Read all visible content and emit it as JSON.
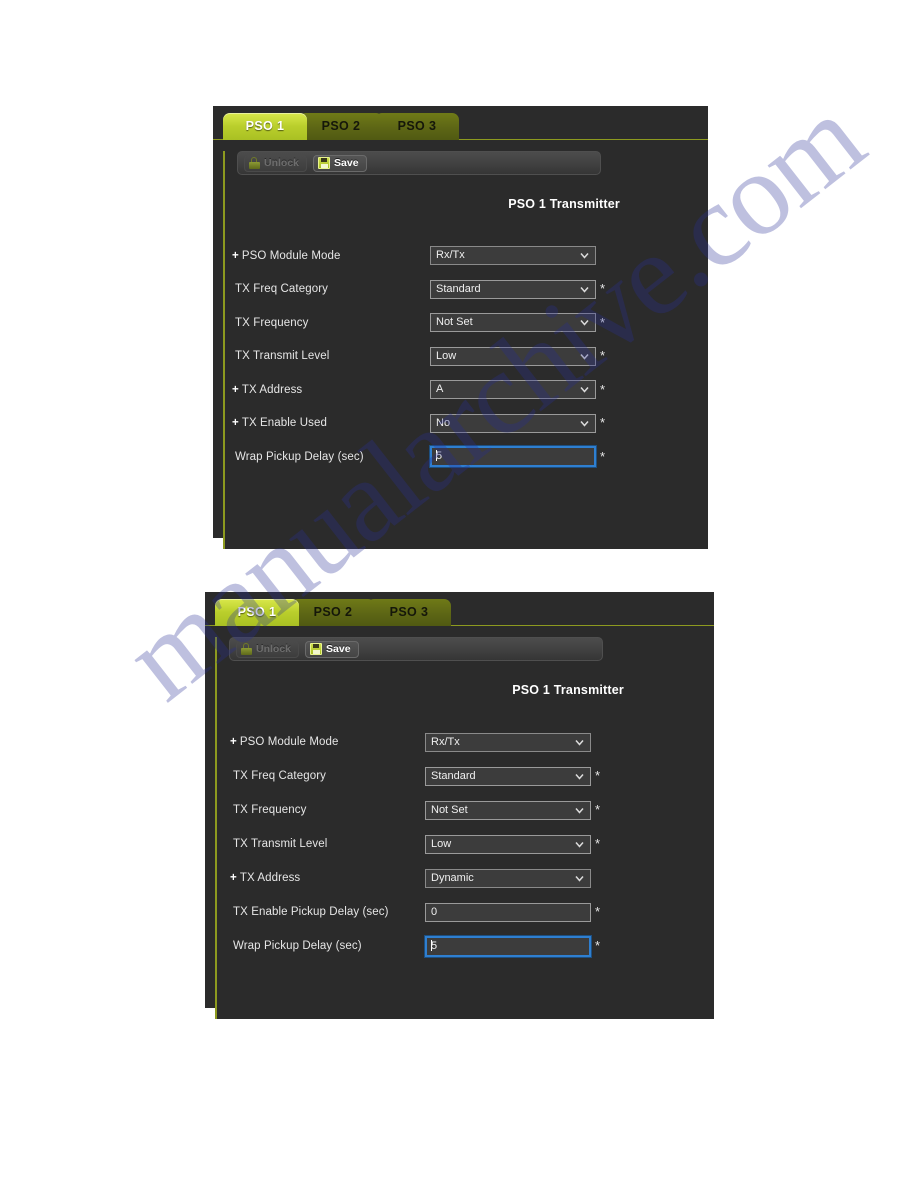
{
  "watermark": {
    "text": "manualarchive.com"
  },
  "panels": [
    {
      "id": "panel-1",
      "tabs": [
        {
          "label": "PSO 1",
          "active": true
        },
        {
          "label": "PSO 2",
          "active": false
        },
        {
          "label": "PSO 3",
          "active": false
        }
      ],
      "toolbar": {
        "unlock_label": "Unlock",
        "save_label": "Save"
      },
      "title": "PSO 1 Transmitter",
      "rows": [
        {
          "plus": "+",
          "label": "PSO Module Mode",
          "type": "select",
          "value": "Rx/Tx",
          "required": false
        },
        {
          "plus": "",
          "label": "TX Freq Category",
          "type": "select",
          "value": "Standard",
          "required": true
        },
        {
          "plus": "",
          "label": "TX Frequency",
          "type": "select",
          "value": "Not Set",
          "required": true
        },
        {
          "plus": "",
          "label": "TX Transmit Level",
          "type": "select",
          "value": "Low",
          "required": true
        },
        {
          "plus": "+",
          "label": "TX Address",
          "type": "select",
          "value": "A",
          "required": true
        },
        {
          "plus": "+",
          "label": "TX Enable Used",
          "type": "select",
          "value": "No",
          "required": true
        },
        {
          "plus": "",
          "label": "Wrap Pickup Delay (sec)",
          "type": "text",
          "value": "5",
          "required": true,
          "focused": true
        }
      ]
    },
    {
      "id": "panel-2",
      "tabs": [
        {
          "label": "PSO 1",
          "active": true
        },
        {
          "label": "PSO 2",
          "active": false
        },
        {
          "label": "PSO 3",
          "active": false
        }
      ],
      "toolbar": {
        "unlock_label": "Unlock",
        "save_label": "Save"
      },
      "title": "PSO 1 Transmitter",
      "rows": [
        {
          "plus": "+",
          "label": "PSO Module Mode",
          "type": "select",
          "value": "Rx/Tx",
          "required": false
        },
        {
          "plus": "",
          "label": "TX Freq Category",
          "type": "select",
          "value": "Standard",
          "required": true
        },
        {
          "plus": "",
          "label": "TX Frequency",
          "type": "select",
          "value": "Not Set",
          "required": true
        },
        {
          "plus": "",
          "label": "TX Transmit Level",
          "type": "select",
          "value": "Low",
          "required": true
        },
        {
          "plus": "+",
          "label": "TX Address",
          "type": "select",
          "value": "Dynamic",
          "required": false
        },
        {
          "plus": "",
          "label": "TX Enable Pickup Delay (sec)",
          "type": "text",
          "value": "0",
          "required": true
        },
        {
          "plus": "",
          "label": "Wrap Pickup Delay (sec)",
          "type": "text",
          "value": "5",
          "required": true,
          "focused": true
        }
      ]
    }
  ],
  "colors": {
    "panel_bg": "#2b2b2b",
    "tab_active": "#bacf2c",
    "tab_inactive": "#5d6615",
    "accent_line": "#8d9a1f",
    "field_bg": "#3c3c3c",
    "focus_border": "#2f7fd0"
  }
}
